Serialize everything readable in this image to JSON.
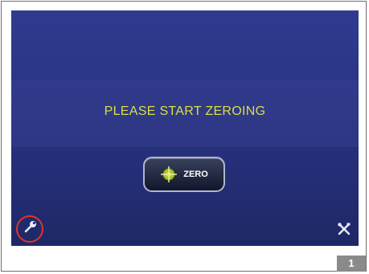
{
  "screen": {
    "message": "PLEASE START ZEROING",
    "zero_button": {
      "label": "ZERO",
      "icon": "crosshair-icon"
    },
    "left_icon": "wrench-icon",
    "right_icon": "tools-icon"
  },
  "page_badge": "1",
  "colors": {
    "screen_background": "#27317d",
    "message_text": "#d9de46",
    "highlight_ring": "#e1342c",
    "badge_background": "#8a8a8a"
  }
}
